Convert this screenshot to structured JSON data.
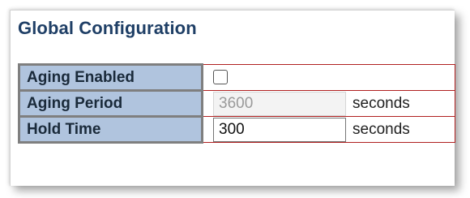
{
  "section": {
    "title": "Global Configuration"
  },
  "rows": [
    {
      "label": "Aging Enabled",
      "checked": false
    },
    {
      "label": "Aging Period",
      "value": "3600",
      "unit": "seconds",
      "disabled": true
    },
    {
      "label": "Hold Time",
      "value": "300",
      "unit": "seconds",
      "disabled": false
    }
  ],
  "colors": {
    "label_bg": "#b0c4de",
    "border": "#b02020",
    "title": "#1f3f66"
  }
}
